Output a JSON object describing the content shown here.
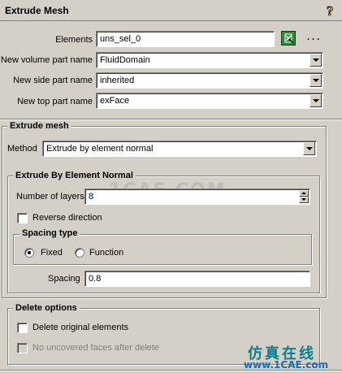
{
  "panel": {
    "title": "Extrude Mesh"
  },
  "fields": {
    "elements": {
      "label": "Elements",
      "value": "uns_sel_0"
    },
    "volume_part": {
      "label": "New volume part name",
      "value": "FluidDomain"
    },
    "side_part": {
      "label": "New side part name",
      "value": "inherited"
    },
    "top_part": {
      "label": "New top part name",
      "value": "exFace"
    },
    "more": "..."
  },
  "extrude_mesh": {
    "title": "Extrude mesh",
    "method_label": "Method",
    "method_value": "Extrude by element normal",
    "element_normal": {
      "title": "Extrude By Element Normal",
      "layers_label": "Number of layers",
      "layers_value": "8",
      "reverse_label": "Reverse direction",
      "spacing_type": {
        "title": "Spacing type",
        "options": [
          "Fixed",
          "Function"
        ],
        "selected": "Fixed"
      },
      "spacing_label": "Spacing",
      "spacing_value": "0.8"
    }
  },
  "delete_options": {
    "title": "Delete options",
    "delete_original_label": "Delete original elements",
    "no_uncovered_label": "No uncovered faces after delete"
  },
  "watermark": {
    "middle": "1CAE.COM",
    "chinese": "仿真在线",
    "url": "www.1CAE.com"
  },
  "icons": {
    "help": "help-question-icon",
    "select": "select-elements-icon"
  }
}
